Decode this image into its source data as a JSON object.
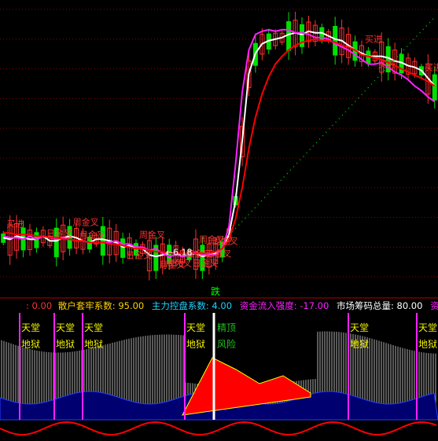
{
  "chart_data": [
    {
      "type": "candlestick",
      "title": "",
      "price_annotations": [
        {
          "text": "买进",
          "color": "#ff3030"
        },
        {
          "text": "买进",
          "color": "#ff3030"
        },
        {
          "text": "买进",
          "color": "#ff3030"
        },
        {
          "text": "买进",
          "color": "#ff3030"
        },
        {
          "text": "日金叉",
          "color": "#ff3030"
        },
        {
          "text": "日金叉",
          "color": "#ff3030"
        },
        {
          "text": "周金叉",
          "color": "#ff3030"
        },
        {
          "text": "月金叉",
          "color": "#ff3030"
        },
        {
          "text": "月金叉",
          "color": "#ff3030"
        },
        {
          "text": "周金叉",
          "color": "#ff3030"
        },
        {
          "text": "日金叉",
          "color": "#ff3030"
        },
        {
          "text": "周死叉",
          "color": "#ff3030"
        },
        {
          "text": "周金叉",
          "color": "#ff3030"
        },
        {
          "text": "日金叉",
          "color": "#ff3030"
        },
        {
          "text": "日金叉",
          "color": "#ff3030"
        },
        {
          "text": "周金叉",
          "color": "#ff3030"
        },
        {
          "text": "←6.18",
          "color": "#ffffff"
        }
      ],
      "ma_lines": [
        {
          "color": "#ffffff",
          "values": [
            0.73,
            0.72,
            0.74,
            0.73,
            0.72,
            0.72,
            0.74,
            0.71,
            0.71,
            0.73,
            0.74,
            0.73,
            0.71,
            0.7,
            0.72,
            0.72,
            0.71,
            0.7,
            0.67,
            0.68,
            0.66,
            0.66,
            0.62,
            0.61,
            0.62,
            0.63,
            0.63,
            0.61,
            0.62,
            0.63,
            0.61,
            0.62,
            0.63,
            0.66,
            0.75,
            0.97,
            1.35,
            1.78,
            1.91,
            1.97,
            1.99,
            2.0,
            2.01,
            2.03,
            2.04,
            2.03,
            2.05,
            2.04,
            2.04,
            2.02,
            2.0,
            1.99,
            1.96,
            1.93,
            1.91,
            1.89,
            1.89,
            1.89,
            1.88,
            1.86,
            1.85,
            1.83,
            1.82,
            1.8,
            1.75,
            1.7
          ]
        },
        {
          "color": "#ff20ff",
          "values": [
            0.74,
            0.73,
            0.73,
            0.72,
            0.74,
            0.72,
            0.74,
            0.73,
            0.72,
            0.73,
            0.72,
            0.71,
            0.71,
            0.7,
            0.7,
            0.7,
            0.7,
            0.71,
            0.69,
            0.69,
            0.67,
            0.67,
            0.65,
            0.66,
            0.63,
            0.61,
            0.62,
            0.61,
            0.62,
            0.64,
            0.62,
            0.62,
            0.62,
            0.66,
            0.8,
            1.2,
            1.66,
            1.93,
            2.03,
            2.05,
            2.06,
            2.05,
            2.06,
            2.06,
            2.04,
            2.04,
            2.03,
            2.01,
            2.01,
            2.0,
            1.97,
            1.95,
            1.93,
            1.9,
            1.87,
            1.84,
            1.84,
            1.85,
            1.82,
            1.79,
            1.77,
            1.74,
            1.7,
            1.67,
            1.63,
            1.6
          ]
        },
        {
          "color": "#ff0000",
          "values": [
            0.76,
            0.76,
            0.75,
            0.75,
            0.75,
            0.74,
            0.74,
            0.73,
            0.73,
            0.72,
            0.72,
            0.71,
            0.71,
            0.7,
            0.7,
            0.7,
            0.69,
            0.69,
            0.68,
            0.67,
            0.66,
            0.66,
            0.65,
            0.64,
            0.64,
            0.63,
            0.63,
            0.63,
            0.63,
            0.63,
            0.63,
            0.63,
            0.64,
            0.66,
            0.72,
            0.85,
            1.05,
            1.3,
            1.5,
            1.65,
            1.76,
            1.84,
            1.89,
            1.93,
            1.96,
            1.98,
            1.99,
            2.0,
            1.99,
            1.99,
            1.98,
            1.96,
            1.95,
            1.93,
            1.9,
            1.89,
            1.88,
            1.87,
            1.85,
            1.83,
            1.81,
            1.79,
            1.77,
            1.75,
            1.73,
            1.7
          ]
        }
      ]
    },
    {
      "type": "indicator",
      "title": "",
      "markers": [
        {
          "top": "天堂",
          "bottom": "地狱"
        },
        {
          "top": "天堂",
          "bottom": "地狱"
        },
        {
          "top": "天堂",
          "bottom": "地狱"
        },
        {
          "top": "天堂",
          "bottom": "地狱"
        },
        {
          "top": "天堂",
          "bottom": "地狱"
        },
        {
          "top": "天堂",
          "bottom": "地狱"
        }
      ],
      "warning": {
        "top": "顶",
        "bottom": "风险",
        "top_glyph": "精"
      }
    }
  ],
  "ui": {
    "divider_label": "跌",
    "info_values": ": 0.00",
    "info_item1": "散户套牢系数: 95.00",
    "info_item2": "主力控盘系数: 4.00",
    "info_item3": "资金流入强度: -17.00",
    "info_item4": "市场筹码总量: 80.00",
    "info_item5": "资金流",
    "colors": {
      "background": "#000000",
      "up": "#ff3030",
      "down": "#00e000",
      "grid": "#8b0000",
      "magenta": "#ff20ff",
      "yellow": "#f0f000",
      "cyan": "#20c0ff"
    }
  }
}
